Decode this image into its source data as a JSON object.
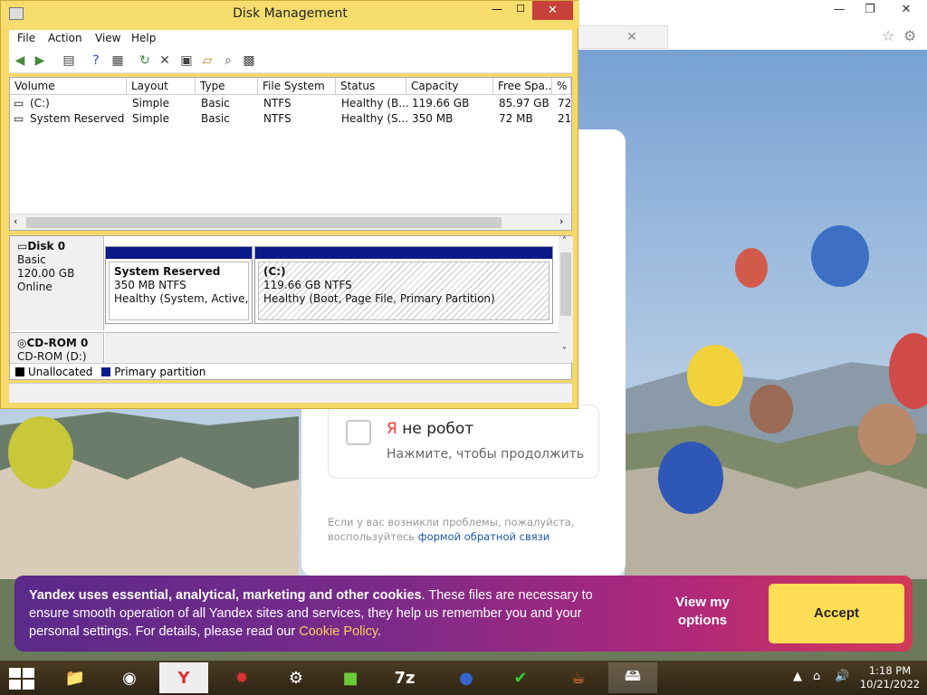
{
  "colors": {
    "accent_cookie": "#7a2a8a",
    "accept_bg": "#ffdd55",
    "partition_bar": "#0b1a8a",
    "captcha_ya": "#ff3333"
  },
  "disk_management": {
    "title": "Disk Management",
    "menu": [
      "File",
      "Action",
      "View",
      "Help"
    ],
    "columns": [
      "Volume",
      "Layout",
      "Type",
      "File System",
      "Status",
      "Capacity",
      "Free Spa...",
      "% F"
    ],
    "rows": [
      [
        "(C:)",
        "Simple",
        "Basic",
        "NTFS",
        "Healthy (B...",
        "119.66 GB",
        "85.97 GB",
        "72"
      ],
      [
        "System Reserved",
        "Simple",
        "Basic",
        "NTFS",
        "Healthy (S...",
        "350 MB",
        "72 MB",
        "21"
      ]
    ],
    "disk0": {
      "name": "Disk 0",
      "type": "Basic",
      "size": "120.00 GB",
      "state": "Online"
    },
    "partitions": [
      {
        "name": "System Reserved",
        "size": "350 MB NTFS",
        "status": "Healthy (System, Active, Prir"
      },
      {
        "name": "(C:)",
        "size": "119.66 GB NTFS",
        "status": "Healthy (Boot, Page File, Primary Partition)"
      }
    ],
    "cdrom": {
      "name": "CD-ROM 0",
      "drive": "CD-ROM (D:)"
    },
    "legend": [
      "Unallocated",
      "Primary partition"
    ]
  },
  "captcha": {
    "ya": "Я",
    "label": " не робот",
    "hint": "Нажмите, чтобы продолжить",
    "problem": "Если у вас возникли проблемы, пожалуйста, воспользуйтесь",
    "link": "формой обратной связи"
  },
  "cookie": {
    "bold": "Yandex uses essential, analytical, marketing and other cookies",
    "text": ". These files are necessary to ensure smooth operation of all Yandex sites and services, they help us remember you and your personal settings. For details, please read our ",
    "policy": "Cookie Policy",
    "end": ".",
    "view_options": "View my options",
    "accept": "Accept"
  },
  "taskbar": {
    "time": "1:18 PM",
    "date": "10/21/2022",
    "apps": [
      "file-explorer",
      "chrome",
      "yandex",
      "app-red",
      "steam",
      "minecraft",
      "7zip",
      "sonic",
      "checklist",
      "java",
      "disk-manager"
    ]
  }
}
